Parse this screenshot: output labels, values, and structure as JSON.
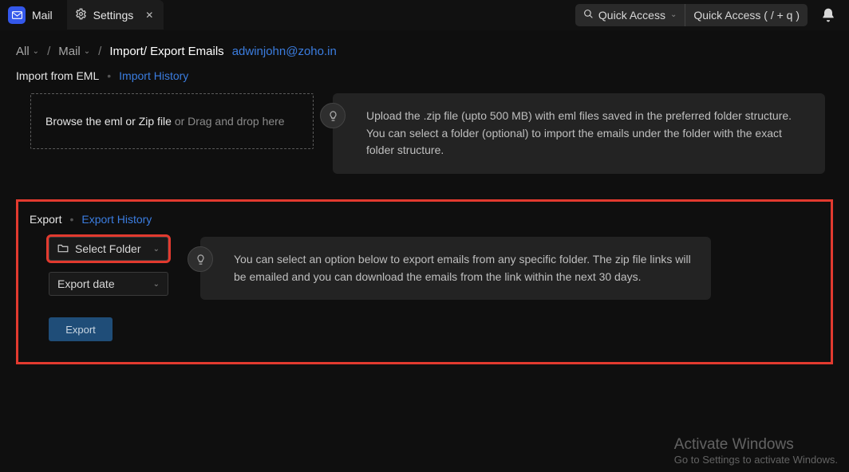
{
  "tabs": {
    "mail_label": "Mail",
    "settings_label": "Settings"
  },
  "quick": {
    "dropdown_label": "Quick Access",
    "shortcut_label": "Quick Access  ( / + q )"
  },
  "breadcrumb": {
    "all": "All",
    "mail": "Mail",
    "current": "Import/ Export Emails",
    "email": "adwinjohn@zoho.in"
  },
  "import": {
    "title": "Import from EML",
    "history_link": "Import History",
    "drop_prefix": "Browse the eml or Zip file",
    "drop_suffix": " or Drag and drop here",
    "tip": "Upload the .zip file (upto 500 MB) with eml files saved in the preferred folder structure. You can select a folder (optional) to import the emails under the folder with the exact folder structure."
  },
  "export": {
    "title": "Export",
    "history_link": "Export History",
    "select_folder": "Select Folder",
    "export_date": "Export date",
    "tip": "You can select an option below to export emails from any specific folder. The zip file links will be emailed and you can download the emails from the link within the next 30 days.",
    "button": "Export"
  },
  "watermark": {
    "line1": "Activate Windows",
    "line2": "Go to Settings to activate Windows."
  }
}
